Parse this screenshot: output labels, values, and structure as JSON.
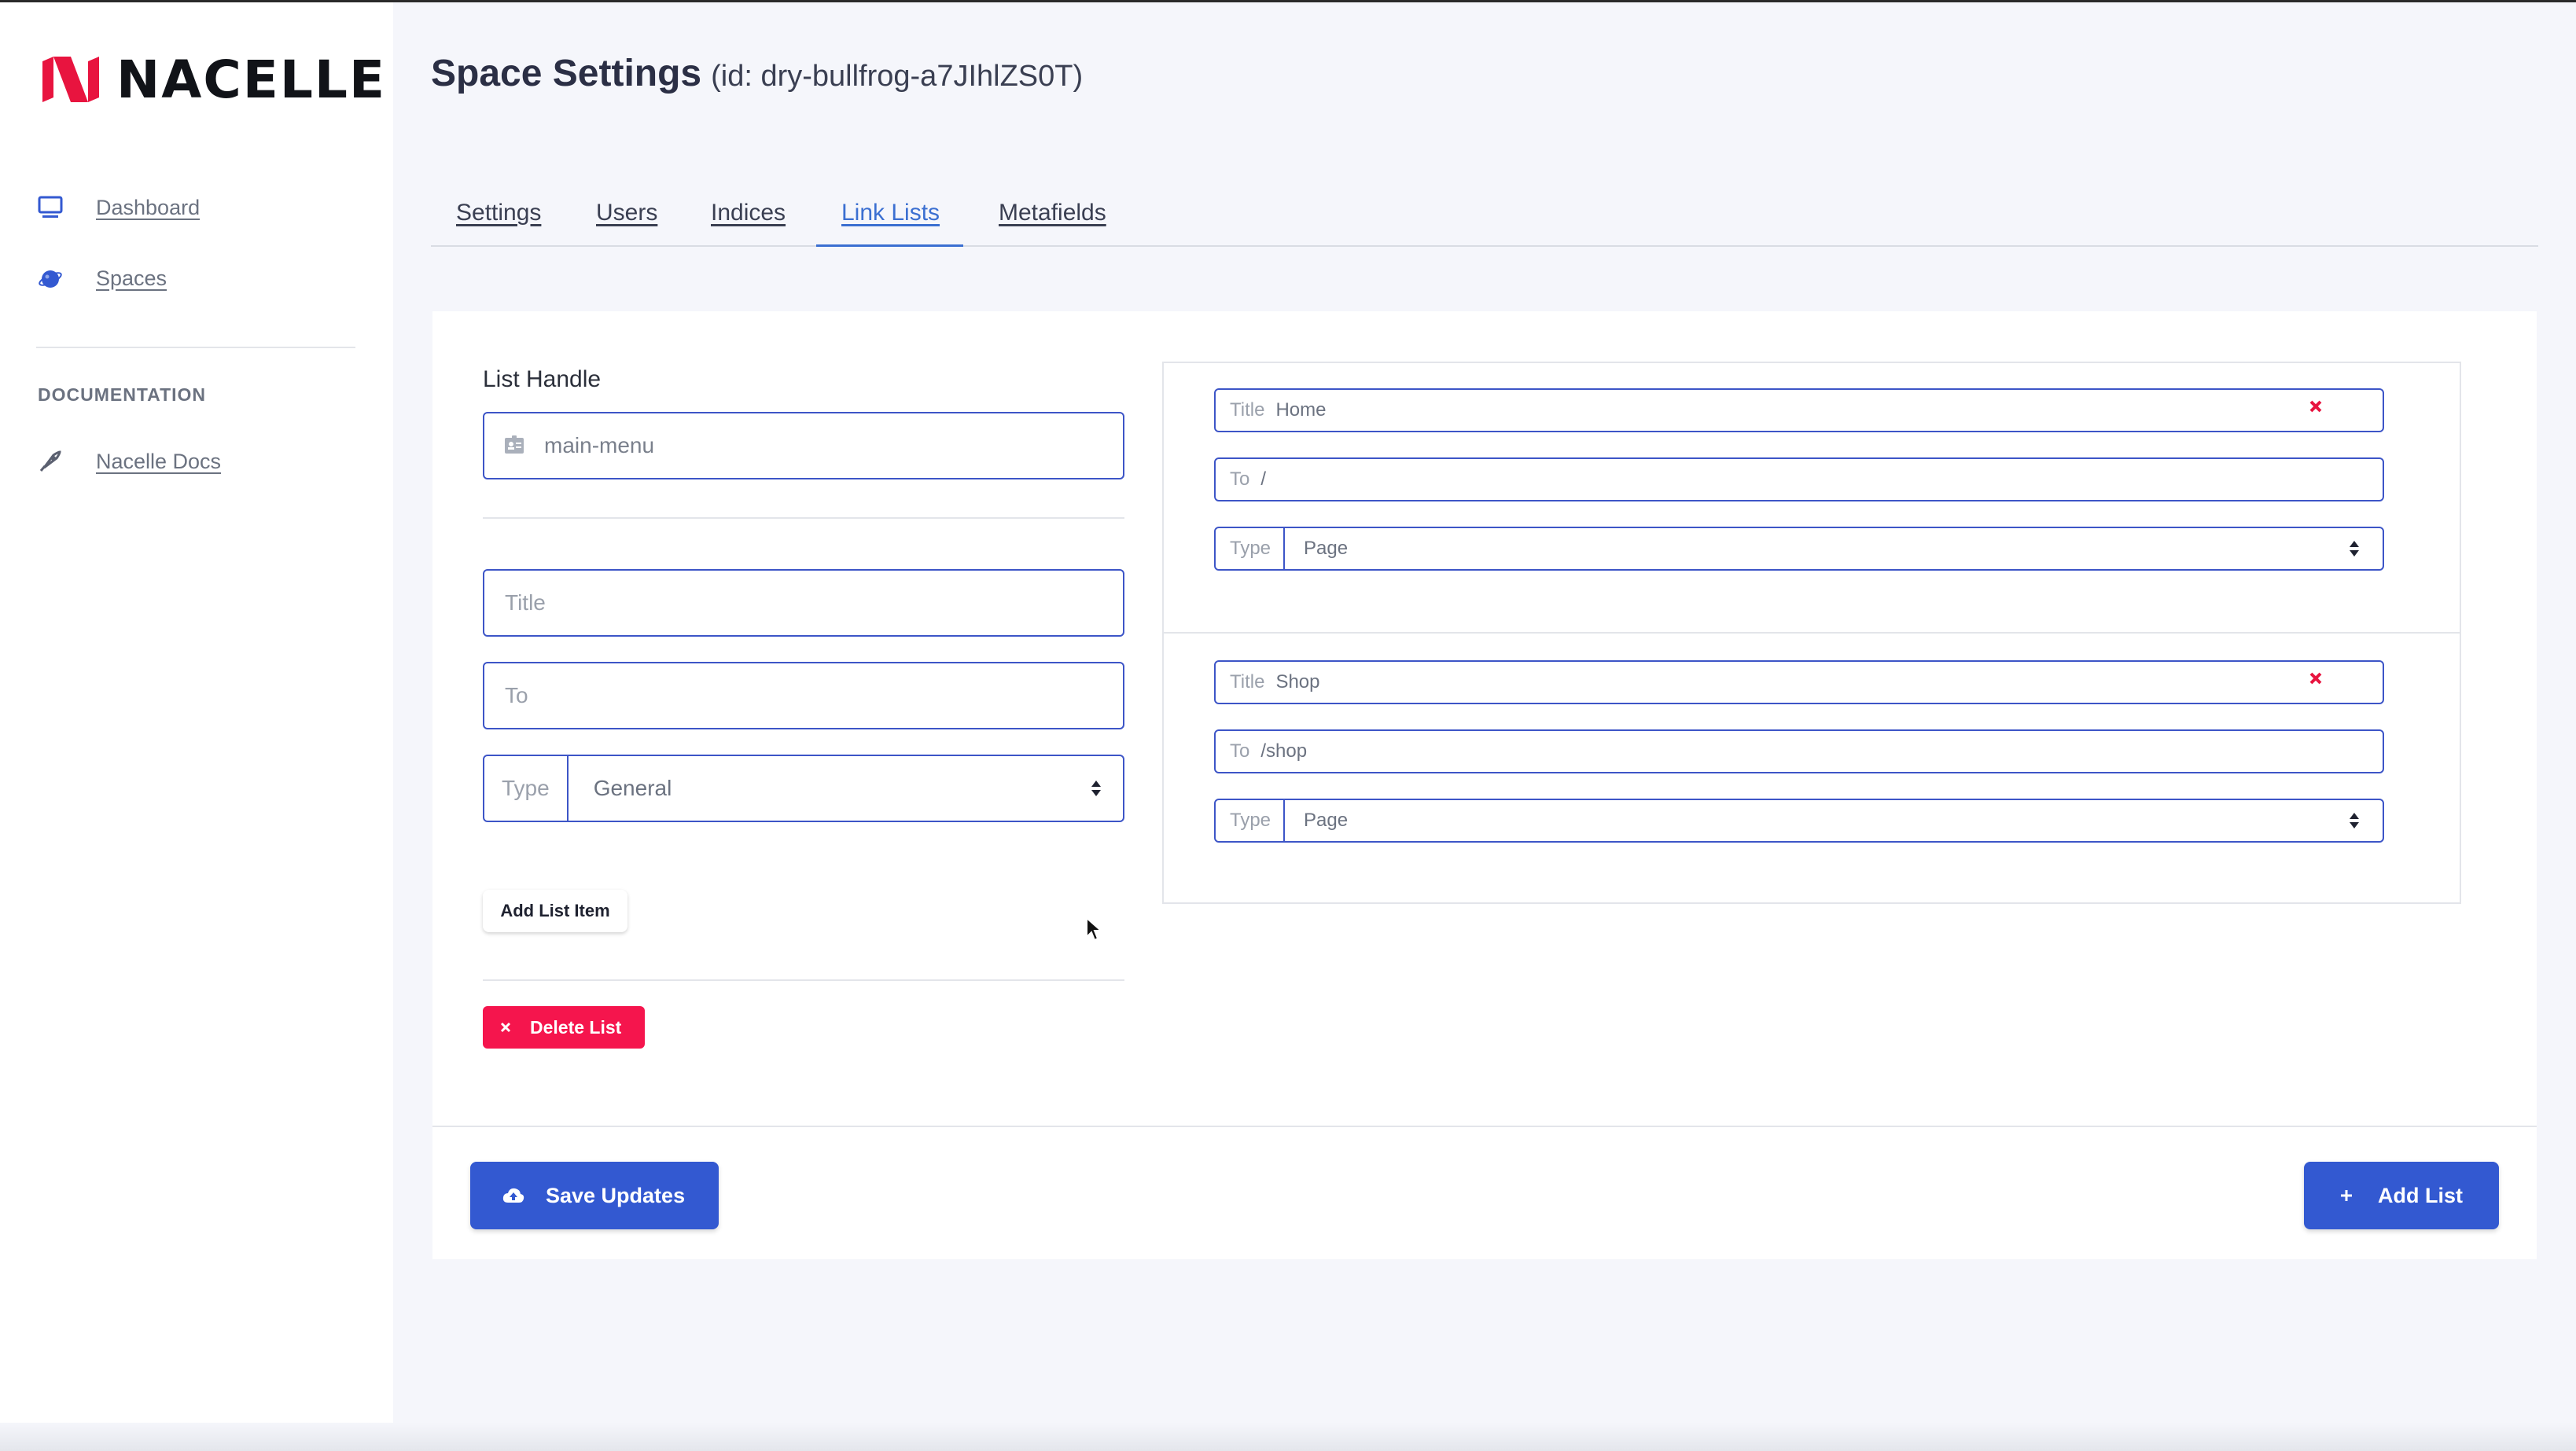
{
  "brand": {
    "name": "NACELLE",
    "logo_icon": "nacelle-logo-icon",
    "accent": "#e8143f"
  },
  "sidebar": {
    "items": [
      {
        "label": "Dashboard",
        "icon": "monitor-icon"
      },
      {
        "label": "Spaces",
        "icon": "planet-icon"
      }
    ],
    "section_title": "DOCUMENTATION",
    "docs": [
      {
        "label": "Nacelle Docs",
        "icon": "rocket-icon"
      }
    ]
  },
  "header": {
    "title": "Space Settings",
    "id_text": "(id: dry-bullfrog-a7JIhlZS0T)"
  },
  "tabs": [
    {
      "label": "Settings",
      "active": false
    },
    {
      "label": "Users",
      "active": false
    },
    {
      "label": "Indices",
      "active": false
    },
    {
      "label": "Link Lists",
      "active": true
    },
    {
      "label": "Metafields",
      "active": false
    }
  ],
  "form": {
    "list_handle_label": "List Handle",
    "list_handle_value": "main-menu",
    "title_placeholder": "Title",
    "to_placeholder": "To",
    "type_prefix": "Type",
    "type_value": "General",
    "add_item_label": "Add List Item",
    "delete_list_label": "Delete List"
  },
  "link_items": [
    {
      "title_prefix": "Title",
      "title": "Home",
      "to_prefix": "To",
      "to": "/",
      "type_prefix": "Type",
      "type": "Page"
    },
    {
      "title_prefix": "Title",
      "title": "Shop",
      "to_prefix": "To",
      "to": "/shop",
      "type_prefix": "Type",
      "type": "Page"
    }
  ],
  "footer": {
    "save_label": "Save Updates",
    "add_list_label": "Add List"
  },
  "colors": {
    "primary": "#3359d1",
    "danger": "#f5154d",
    "tab_active": "#3b6fd1",
    "input_border": "#3d55c7"
  }
}
